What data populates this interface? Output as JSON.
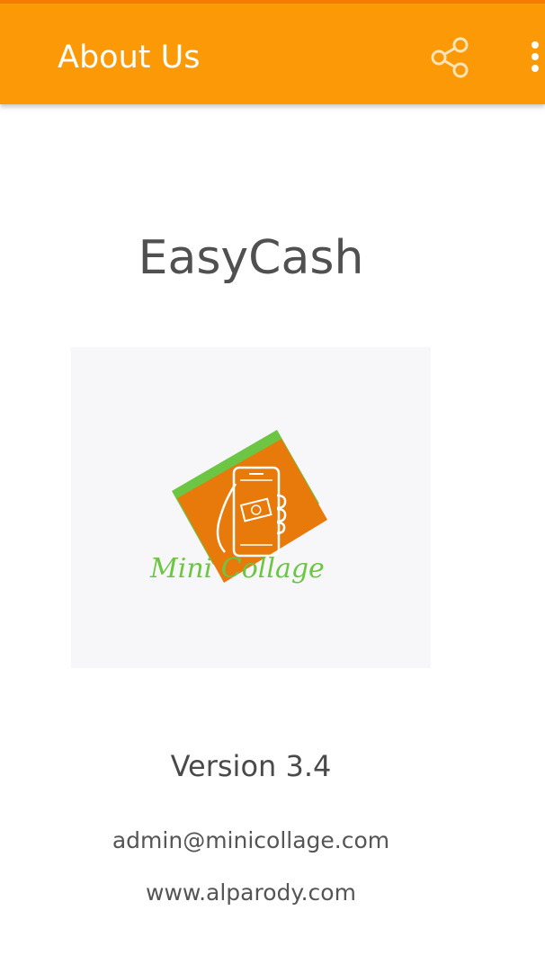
{
  "app_bar": {
    "title": "About Us",
    "background_color": "#FB9A06",
    "share_icon": "share-icon",
    "more_icon": "more-vertical-icon"
  },
  "about": {
    "app_name": "EasyCash",
    "logo_text": "Mini Collage",
    "logo_colors": {
      "orange": "#E87A0C",
      "green": "#6CC644"
    },
    "version": "Version 3.4",
    "email": "admin@minicollage.com",
    "website": "www.alparody.com"
  }
}
